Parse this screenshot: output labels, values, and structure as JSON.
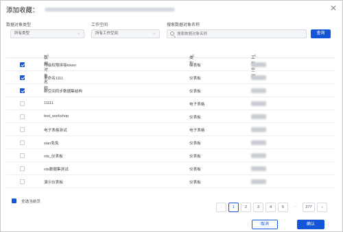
{
  "dialog": {
    "title": "添加收藏：",
    "close_icon": "close-icon"
  },
  "filters": {
    "type_label": "数据对象类型",
    "type_value": "所有类型",
    "workspace_label": "工作空间",
    "workspace_value": "所有工作空间",
    "search_label": "搜索数据对象名称",
    "search_placeholder": "搜索数据对象名称",
    "search_button": "查询"
  },
  "table": {
    "headers": {
      "name": "数据对象名称",
      "type": "类型",
      "workspace": "工作空间"
    },
    "rows": [
      {
        "name": "行级权限拼接token",
        "type": "仪表板",
        "checked": true
      },
      {
        "name": "未命名1111",
        "type": "仪表板",
        "checked": true
      },
      {
        "name": "群空间同步数据集结构",
        "type": "仪表板",
        "checked": true
      },
      {
        "name": "11111",
        "type": "电子表格",
        "checked": false
      },
      {
        "name": "test_workshop",
        "type": "仪表板",
        "checked": false
      },
      {
        "name": "电子表格测试",
        "type": "电子表格",
        "checked": false
      },
      {
        "name": "xian免免",
        "type": "仪表板",
        "checked": false
      },
      {
        "name": "rds_仪表板",
        "type": "仪表板",
        "checked": false
      },
      {
        "name": "rds数据集测试",
        "type": "仪表板",
        "checked": false
      },
      {
        "name": "演示仪表板",
        "type": "仪表板",
        "checked": false
      }
    ]
  },
  "footer": {
    "select_all_label": "全选当前页",
    "pages": [
      "1",
      "2",
      "3",
      "4",
      "5",
      "···",
      "277"
    ],
    "prev_icon": "‹",
    "next_icon": "›",
    "cancel": "取消",
    "confirm": "确认"
  },
  "colors": {
    "accent": "#1456d8"
  }
}
